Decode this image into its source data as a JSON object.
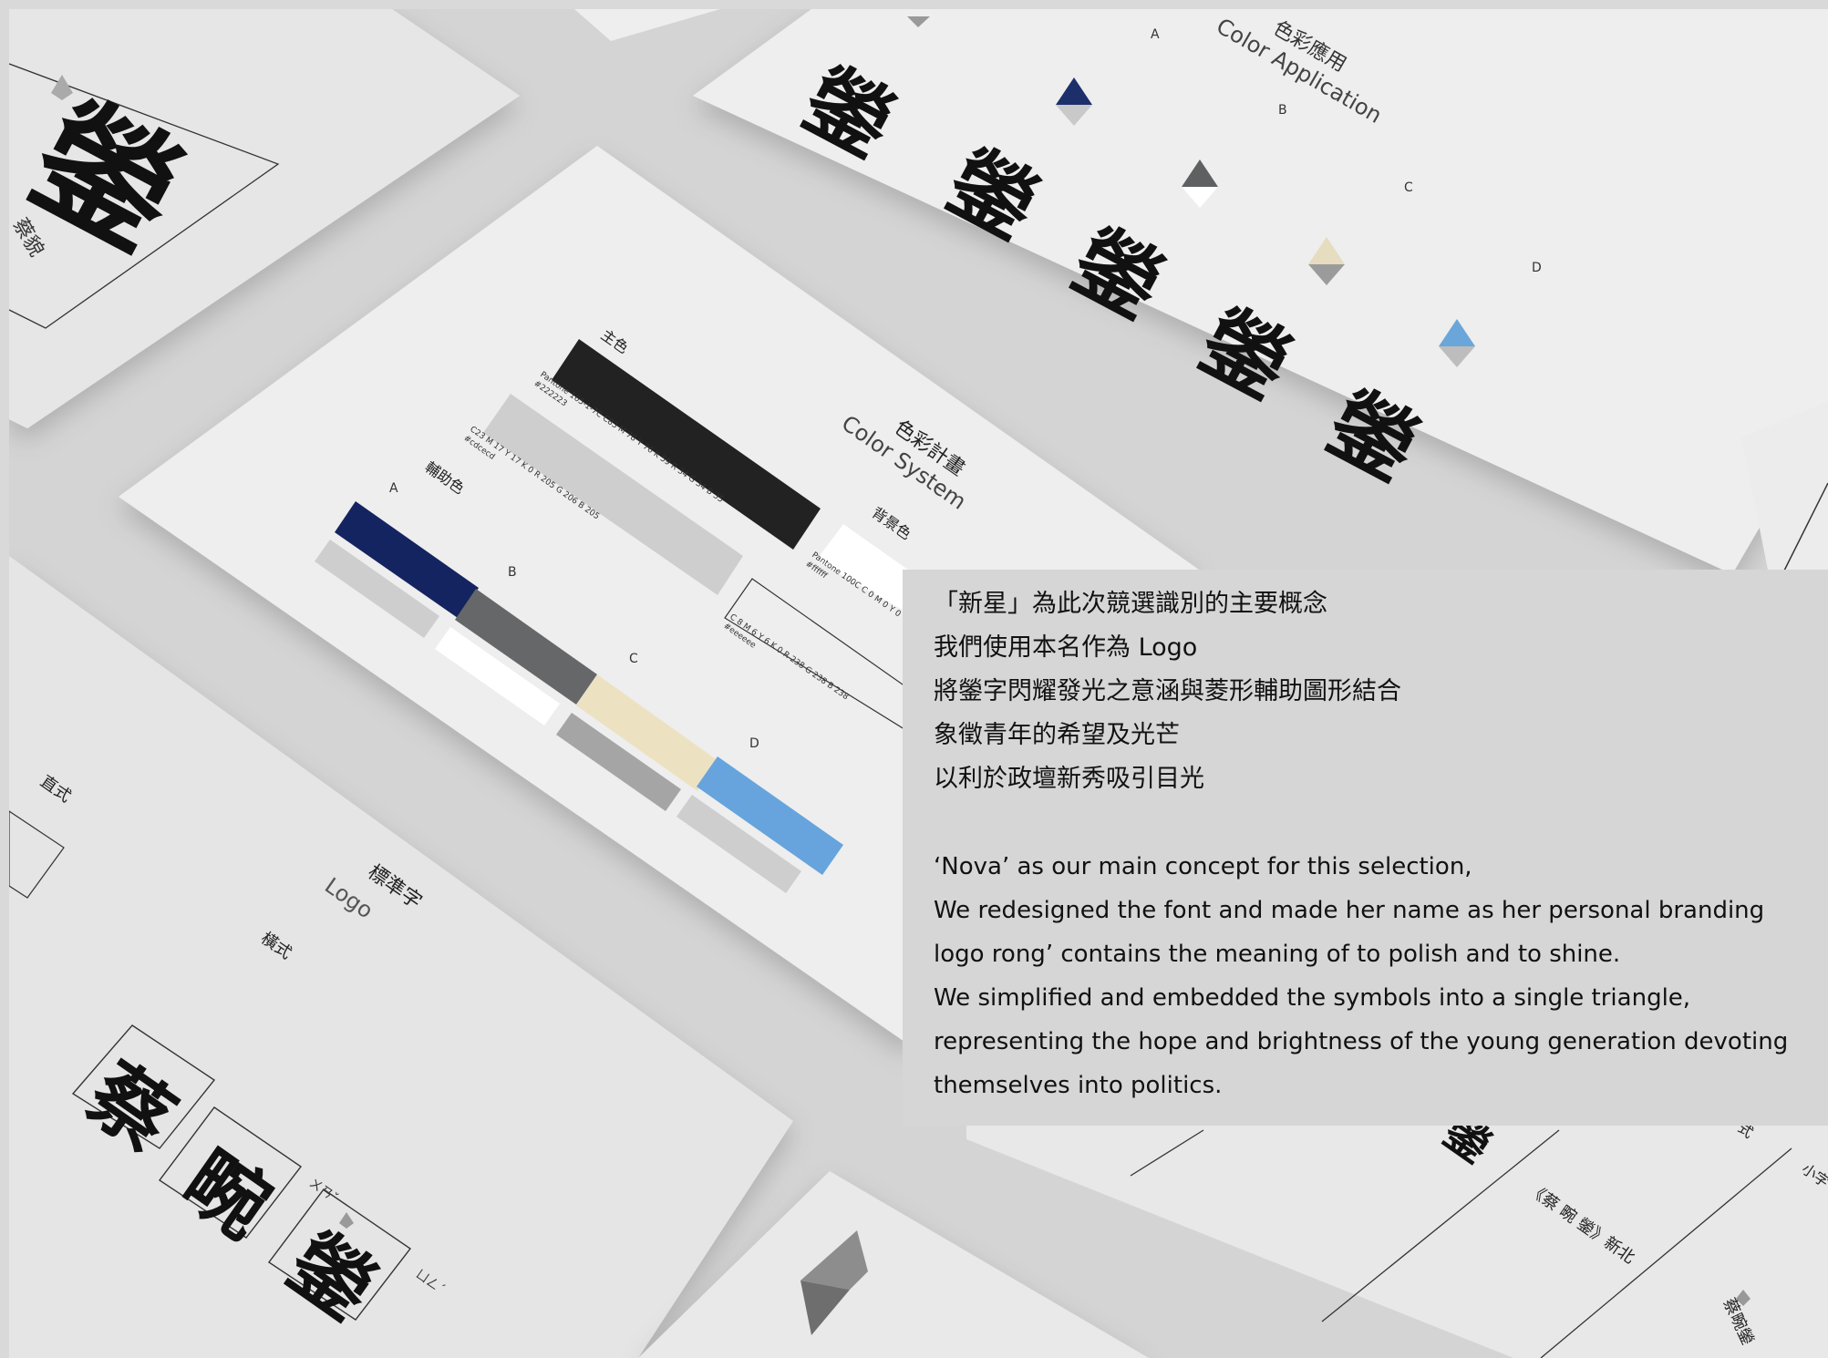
{
  "cards": {
    "top_left": {
      "glyph": "鎣",
      "caption": "蔡貌"
    },
    "color_application": {
      "title_zh": "色彩應用",
      "title_en": "Color Application",
      "variant_labels": [
        "A",
        "B",
        "C",
        "D"
      ],
      "glyph": "鎣"
    },
    "color_system": {
      "title_zh": "色彩計畫",
      "title_en": "Color System",
      "primary_label": "主色",
      "primary_specs": [
        "Pantone 165-1-7C C83 M 78 Y 76 K 59 R 34 G 34 B 35",
        "#222223"
      ],
      "grey_specs": [
        "C23 M 17 Y 17 K 0 R 205 G 206 B 205",
        "#cdcecd"
      ],
      "background_label": "背景色",
      "background_specs": [
        "Pantone 100C C 0 M 0 Y 0",
        "#ffffff"
      ],
      "light_specs": [
        "C 8 M 6 Y 6 K 0 R 238 G 238 B 238",
        "#eeeeee"
      ],
      "aux_label": "輔助色",
      "swatch_labels": [
        "A",
        "B",
        "C",
        "D"
      ],
      "colors": {
        "primary": "#222223",
        "grey": "#cdcecd",
        "background": "#ffffff",
        "navy": "#142460",
        "dark_grey": "#666768",
        "cream": "#ece2c2",
        "blue": "#67a4dd"
      }
    },
    "standard_logo": {
      "title_zh": "標準字",
      "title_en": "Logo",
      "style_vertical": "直式",
      "style_horizontal": "橫式",
      "name_chars": [
        "蔡",
        "畹",
        "鎣"
      ],
      "phonetics": [
        "ㄨㄢˇ",
        "ㄩㄥˊ"
      ]
    },
    "bottom_right": {
      "tagline": "《蔡 畹 鎣》新北",
      "glyph": "鎣",
      "label_small": "小字",
      "label_style": "式",
      "name_vertical": "蔡畹鎣"
    }
  },
  "description": {
    "zh_lines": [
      "「新星」為此次競選識別的主要概念",
      "我們使用本名作為 Logo",
      "將鎣字閃耀發光之意涵與菱形輔助圖形結合",
      "象徵青年的希望及光芒",
      "以利於政壇新秀吸引目光"
    ],
    "en_lines": [
      "‘Nova’ as our main concept for this selection,",
      "We redesigned the font and made her name as her personal branding",
      "logo rong’ contains the meaning of to polish and to shine.",
      "We simplified and embedded the symbols into a single triangle,",
      "representing the hope and brightness of the young generation devoting",
      "themselves into politics."
    ]
  }
}
